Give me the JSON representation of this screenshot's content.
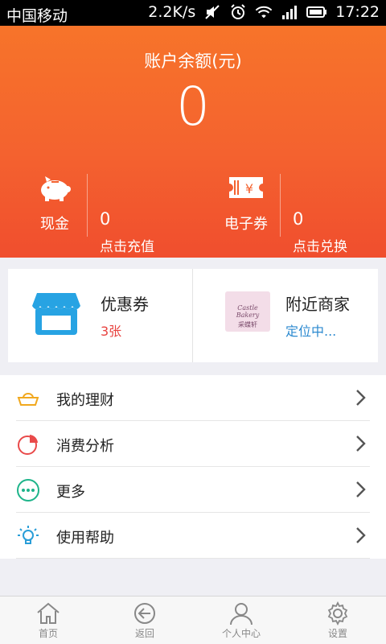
{
  "status_bar": {
    "carrier": "中国移动",
    "net_speed": "2.2K/s",
    "time": "17:22"
  },
  "header": {
    "balance_label": "账户余额(元)",
    "balance_value": "0",
    "cash": {
      "caption": "现金",
      "value": "0",
      "action": "点击充值"
    },
    "voucher": {
      "caption": "电子券",
      "value": "0",
      "action": "点击兑换"
    }
  },
  "cards": {
    "coupons": {
      "title": "优惠券",
      "subtitle": "3张",
      "subtitle_color": "#e8423f"
    },
    "nearby": {
      "title": "附近商家",
      "subtitle": "定位中...",
      "subtitle_color": "#2c8ad0",
      "logo_text": "Castle Bakery",
      "logo_cn": "采蝶轩"
    }
  },
  "menu": [
    {
      "label": "我的理财",
      "icon": "gold-ingot-icon",
      "color": "#f1a81e"
    },
    {
      "label": "消费分析",
      "icon": "pie-chart-icon",
      "color": "#e94a4a"
    },
    {
      "label": "更多",
      "icon": "more-dots-icon",
      "color": "#1eb48a"
    },
    {
      "label": "使用帮助",
      "icon": "lightbulb-icon",
      "color": "#2a9ed8"
    }
  ],
  "bottom_nav": [
    {
      "label": "首页",
      "icon": "home-icon"
    },
    {
      "label": "返回",
      "icon": "back-arrow-icon"
    },
    {
      "label": "个人中心",
      "icon": "person-icon"
    },
    {
      "label": "设置",
      "icon": "gear-icon"
    }
  ]
}
